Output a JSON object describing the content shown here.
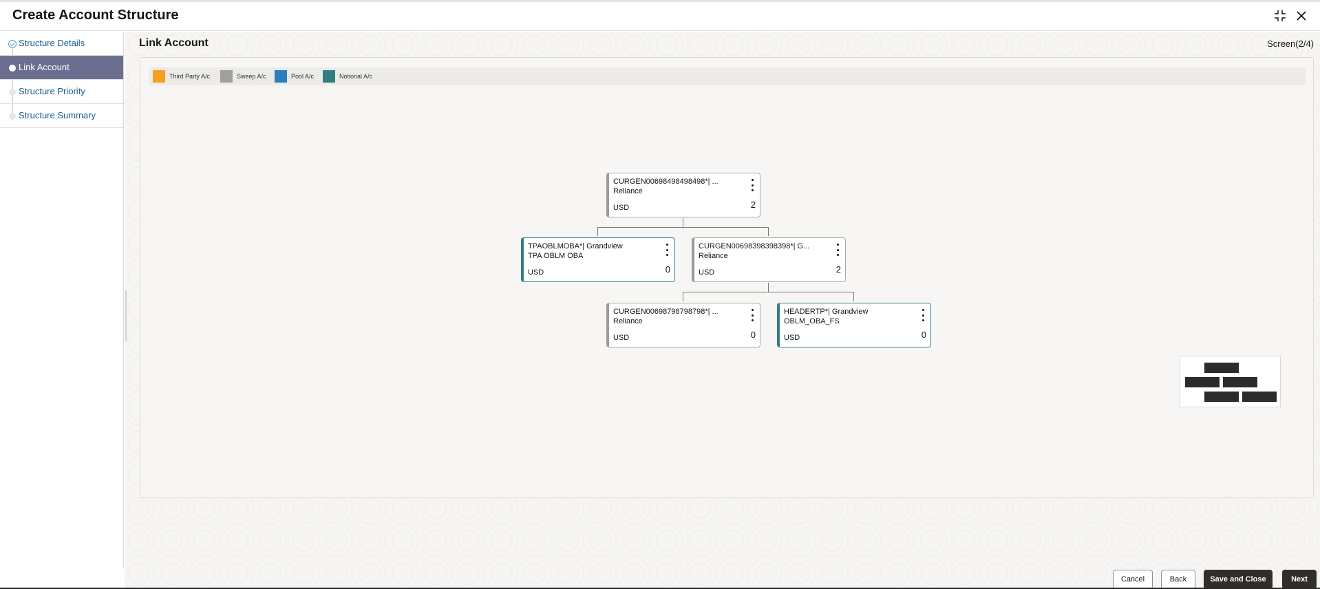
{
  "header": {
    "title": "Create Account Structure"
  },
  "steps": [
    {
      "label": "Structure Details",
      "state": "done"
    },
    {
      "label": "Link Account",
      "state": "active"
    },
    {
      "label": "Structure Priority",
      "state": "pending"
    },
    {
      "label": "Structure Summary",
      "state": "pending"
    }
  ],
  "main": {
    "title": "Link Account",
    "screen": "Screen(2/4)"
  },
  "legend": [
    {
      "label": "Third Party A/c",
      "color": "#f5a020"
    },
    {
      "label": "Sweep A/c",
      "color": "#a09f9c"
    },
    {
      "label": "Pool A/c",
      "color": "#2c7fbe"
    },
    {
      "label": "Notional A/c",
      "color": "#2f7f82"
    }
  ],
  "nodes": [
    {
      "line1": "CURGEN00698498498498*| ...",
      "line2": "Reliance",
      "currency": "USD",
      "count": "2",
      "type": "sweep"
    },
    {
      "line1": "TPAOBLMOBA*| Grandview",
      "line2": "TPA OBLM OBA",
      "currency": "USD",
      "count": "0",
      "type": "notional"
    },
    {
      "line1": "CURGEN00698398398398*| G...",
      "line2": "Reliance",
      "currency": "USD",
      "count": "2",
      "type": "sweep"
    },
    {
      "line1": "CURGEN00698798798798*| ...",
      "line2": "Reliance",
      "currency": "USD",
      "count": "0",
      "type": "sweep"
    },
    {
      "line1": "HEADERTP*| Grandview",
      "line2": "OBLM_OBA_FS",
      "currency": "USD",
      "count": "0",
      "type": "notional"
    }
  ],
  "footer": {
    "cancel": "Cancel",
    "back": "Back",
    "save_close": "Save and Close",
    "next": "Next"
  },
  "icons": {
    "minimize": "minimize-icon",
    "close": "close-icon",
    "node_menu": "kebab-menu-icon",
    "step_done": "check-icon"
  }
}
